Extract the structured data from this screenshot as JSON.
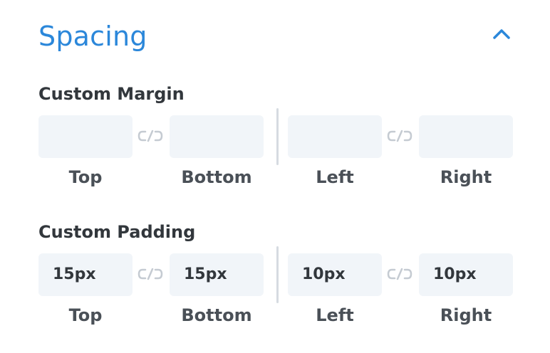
{
  "section": {
    "title": "Spacing",
    "toggle_icon": "chevron-up-icon",
    "accent_color": "#2b87da"
  },
  "margin": {
    "label": "Custom Margin",
    "link_icon": "unlink-icon",
    "fields": [
      {
        "name": "top",
        "value": "",
        "label": "Top"
      },
      {
        "name": "bottom",
        "value": "",
        "label": "Bottom"
      },
      {
        "name": "left",
        "value": "",
        "label": "Left"
      },
      {
        "name": "right",
        "value": "",
        "label": "Right"
      }
    ]
  },
  "padding": {
    "label": "Custom Padding",
    "link_icon": "unlink-icon",
    "fields": [
      {
        "name": "top",
        "value": "15px",
        "label": "Top"
      },
      {
        "name": "bottom",
        "value": "15px",
        "label": "Bottom"
      },
      {
        "name": "left",
        "value": "10px",
        "label": "Left"
      },
      {
        "name": "right",
        "value": "10px",
        "label": "Right"
      }
    ]
  }
}
